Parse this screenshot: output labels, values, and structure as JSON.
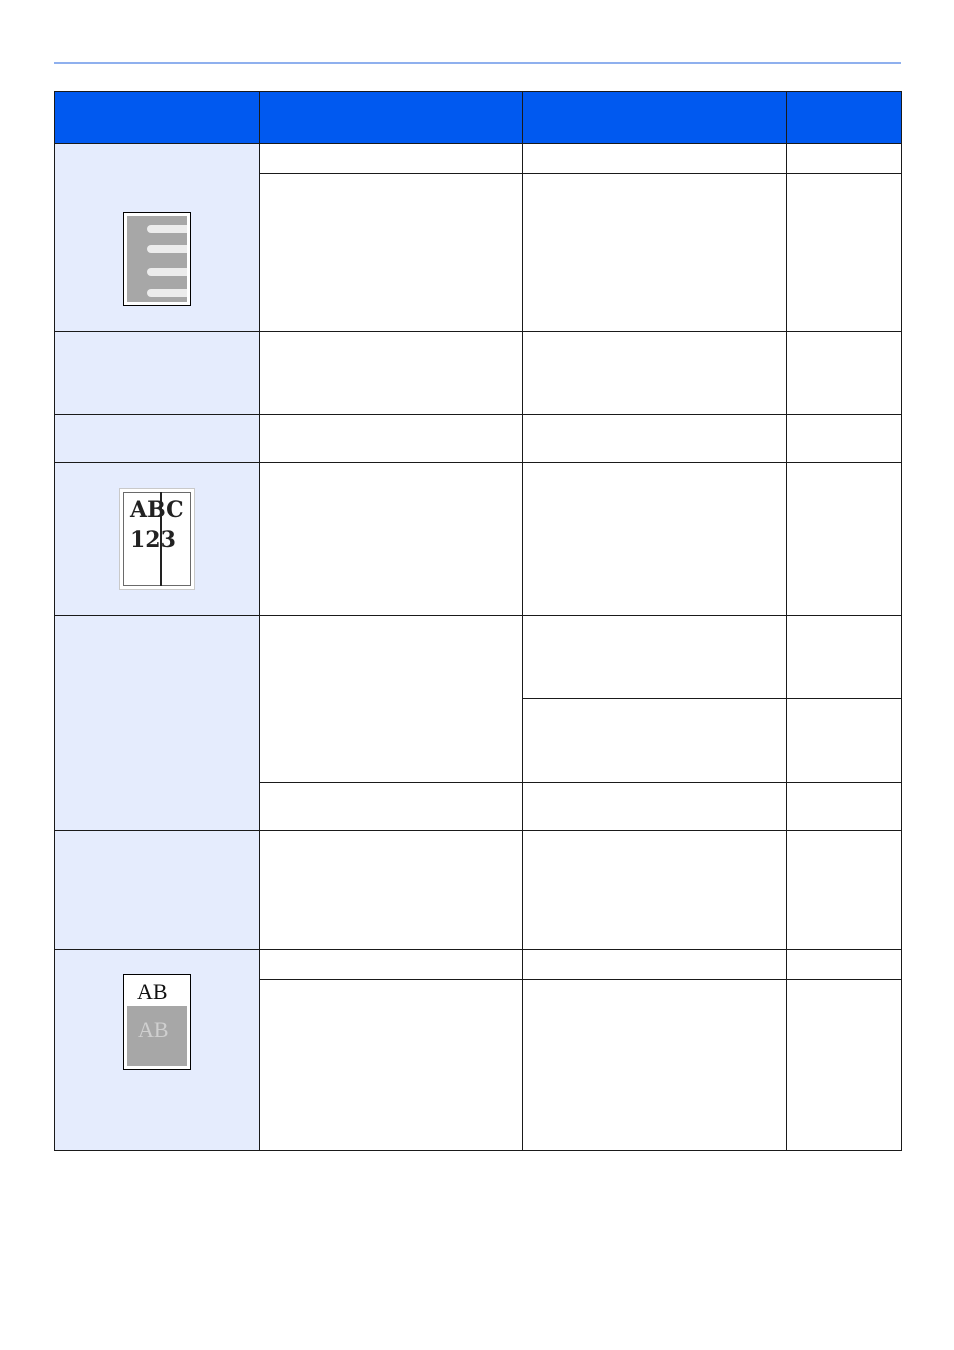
{
  "header": {
    "columns": [
      "",
      "",
      "",
      ""
    ]
  },
  "thumbnails": {
    "text_sample": {
      "line1": "ABC",
      "line2": "123"
    },
    "ab_sample": {
      "top": "AB",
      "ghost": "AB"
    },
    "streak_sample": {
      "icon": "streak-icon"
    }
  },
  "colors": {
    "header_bg": "#0059f0",
    "symptom_bg": "#e5ecfd",
    "top_rule": "#8fb0ee"
  }
}
